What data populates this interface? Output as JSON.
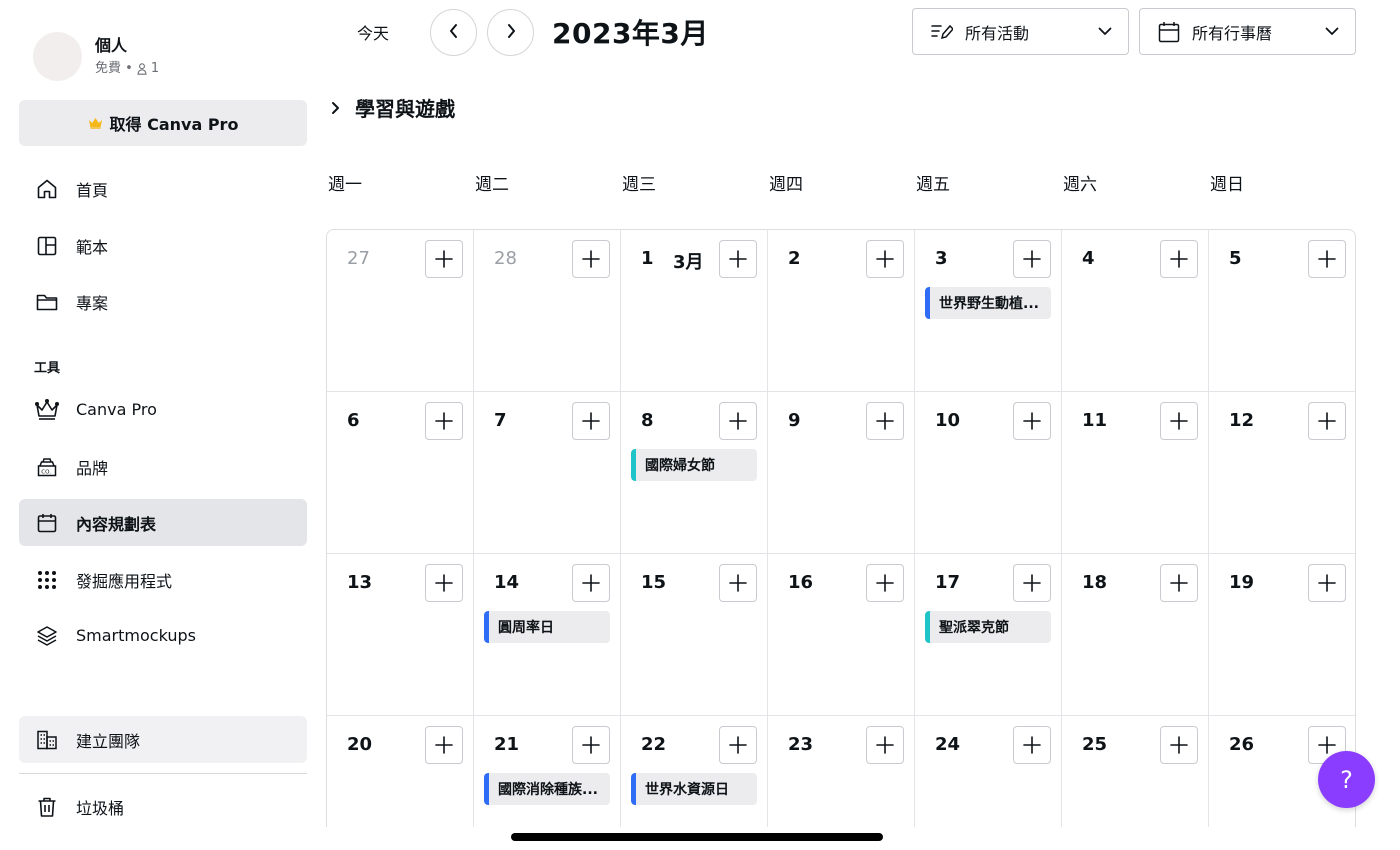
{
  "profile": {
    "name": "個人",
    "plan": "免費 •",
    "members": "1"
  },
  "sidebar": {
    "pro_button": "取得 Canva Pro",
    "nav": [
      {
        "label": "首頁",
        "icon": "home-icon"
      },
      {
        "label": "範本",
        "icon": "templates-icon"
      },
      {
        "label": "專案",
        "icon": "folder-icon"
      }
    ],
    "tools_label": "工具",
    "tools": [
      {
        "label": "Canva Pro",
        "icon": "crown-icon"
      },
      {
        "label": "品牌",
        "icon": "brand-icon"
      },
      {
        "label": "內容規劃表",
        "icon": "calendar-icon",
        "active": true
      },
      {
        "label": "發掘應用程式",
        "icon": "apps-grid-icon"
      },
      {
        "label": "Smartmockups",
        "icon": "layers-icon"
      }
    ],
    "team_label": "建立團隊",
    "trash_label": "垃圾桶"
  },
  "toolbar": {
    "today": "今天",
    "month_title": "2023年3月",
    "activity_filter": "所有活動",
    "calendar_filter": "所有行事曆"
  },
  "section": {
    "title": "學習與遊戲"
  },
  "weekdays": [
    "週一",
    "週二",
    "週三",
    "週四",
    "週五",
    "週六",
    "週日"
  ],
  "weeks": [
    [
      {
        "day": "27",
        "muted": true
      },
      {
        "day": "28",
        "muted": true
      },
      {
        "day": "1",
        "month": "3月"
      },
      {
        "day": "2"
      },
      {
        "day": "3",
        "event": {
          "label": "世界野生動植...",
          "color": "#2f6df6"
        }
      },
      {
        "day": "4"
      },
      {
        "day": "5"
      }
    ],
    [
      {
        "day": "6"
      },
      {
        "day": "7"
      },
      {
        "day": "8",
        "event": {
          "label": "國際婦女節",
          "color": "#1fc4c9"
        }
      },
      {
        "day": "9"
      },
      {
        "day": "10"
      },
      {
        "day": "11"
      },
      {
        "day": "12"
      }
    ],
    [
      {
        "day": "13"
      },
      {
        "day": "14",
        "event": {
          "label": "圓周率日",
          "color": "#2f6df6"
        }
      },
      {
        "day": "15"
      },
      {
        "day": "16"
      },
      {
        "day": "17",
        "event": {
          "label": "聖派翠克節",
          "color": "#1fc4c9"
        }
      },
      {
        "day": "18"
      },
      {
        "day": "19"
      }
    ],
    [
      {
        "day": "20"
      },
      {
        "day": "21",
        "event": {
          "label": "國際消除種族...",
          "color": "#2f6df6"
        }
      },
      {
        "day": "22",
        "event": {
          "label": "世界水資源日",
          "color": "#2f6df6"
        }
      },
      {
        "day": "23"
      },
      {
        "day": "24"
      },
      {
        "day": "25"
      },
      {
        "day": "26"
      }
    ]
  ],
  "help": {
    "label": "?",
    "color": "#8b3dff"
  }
}
